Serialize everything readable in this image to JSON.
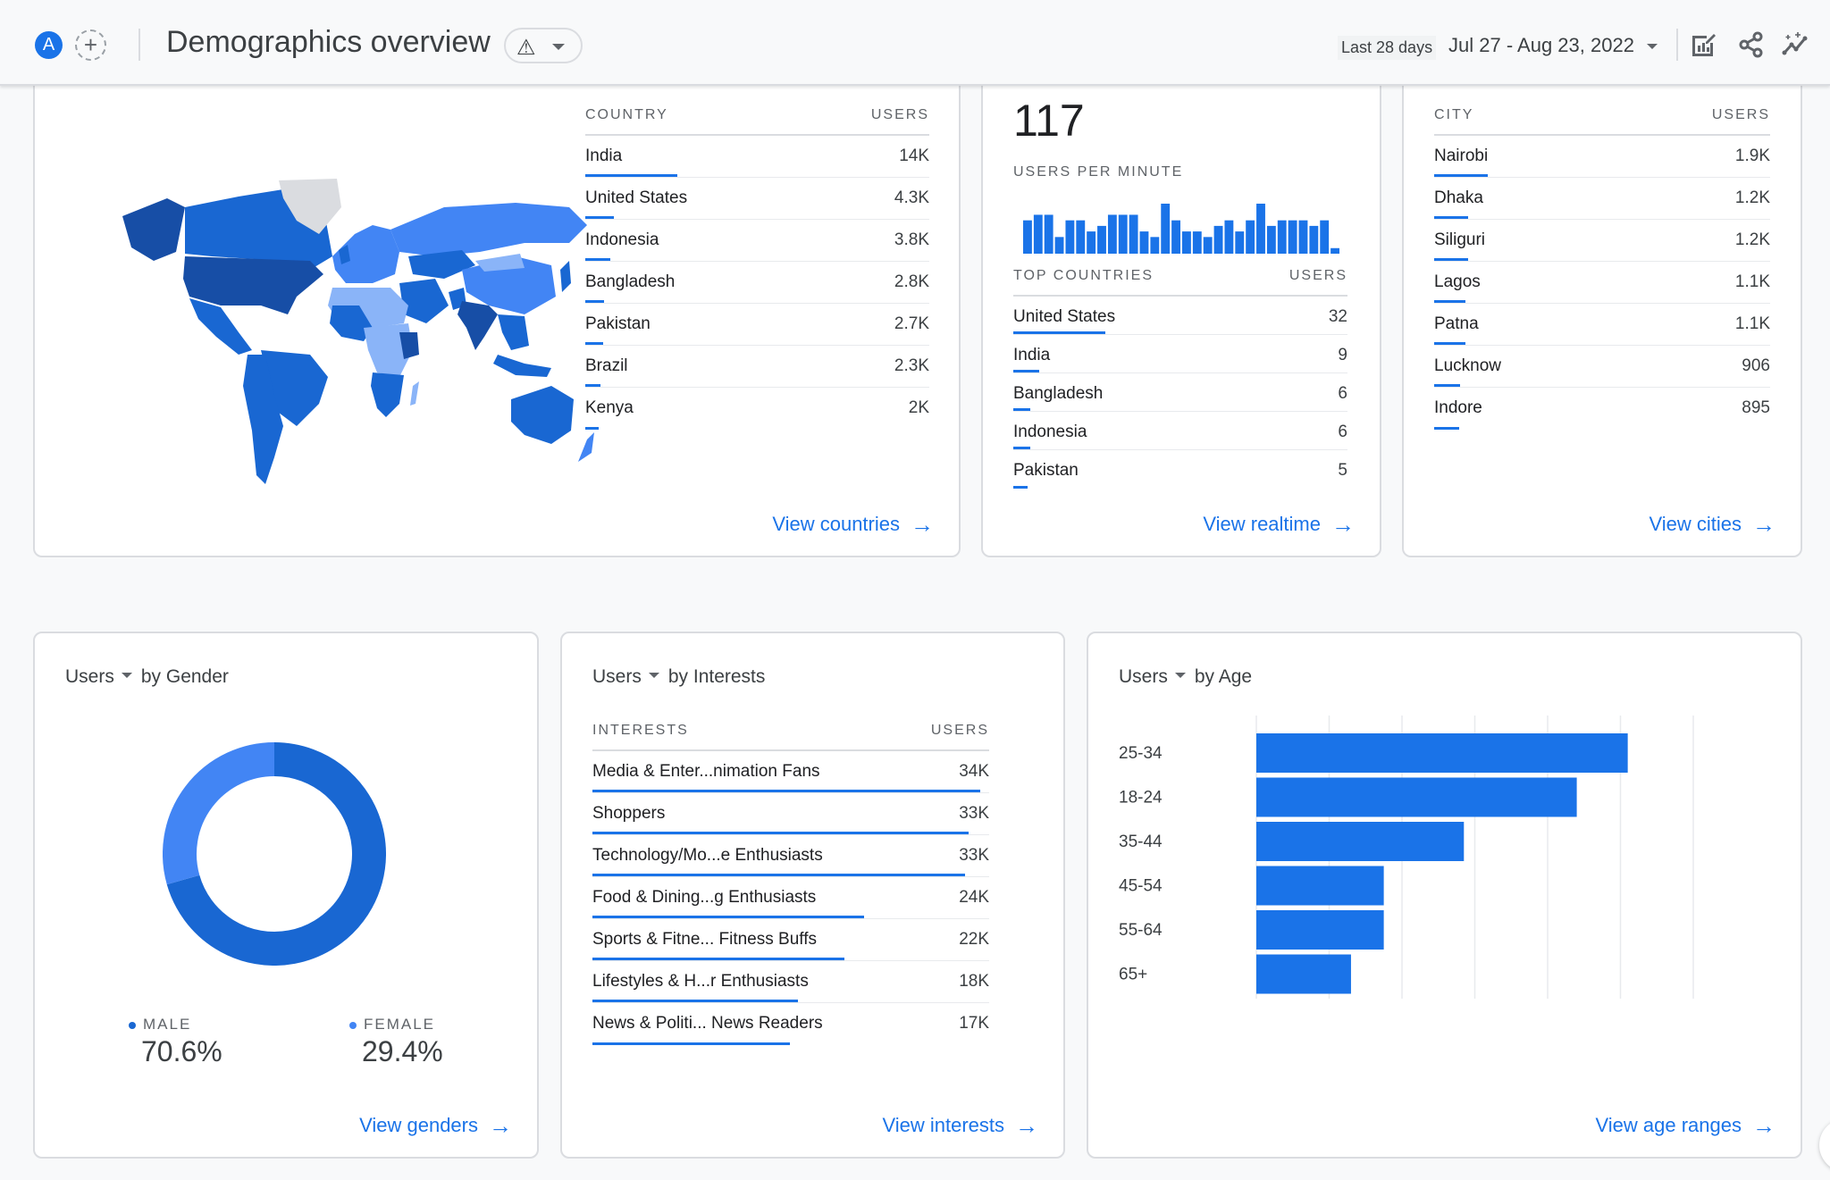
{
  "header": {
    "avatar_letter": "A",
    "add_comparison_icon": "plus-circle-dashed",
    "title": "Demographics overview",
    "warning_icon": "warning-triangle",
    "date_range_label": "Last 28 days",
    "date_range_value": "Jul 27 - Aug 23, 2022",
    "icons": [
      "customize-report-icon",
      "share-icon",
      "insights-icon"
    ]
  },
  "map_card": {
    "map": {
      "description": "World choropleth map of users by country",
      "colors": {
        "highest": "#174ea6",
        "high": "#1967d2",
        "medium": "#4285f4",
        "low": "#8ab4f8",
        "none": "#dadce0"
      }
    },
    "table": {
      "col_name": "COUNTRY",
      "col_value": "USERS",
      "rows": [
        {
          "name": "India",
          "value": "14K",
          "share": 1.0
        },
        {
          "name": "United States",
          "value": "4.3K",
          "share": 0.307
        },
        {
          "name": "Indonesia",
          "value": "3.8K",
          "share": 0.271
        },
        {
          "name": "Bangladesh",
          "value": "2.8K",
          "share": 0.2
        },
        {
          "name": "Pakistan",
          "value": "2.7K",
          "share": 0.193
        },
        {
          "name": "Brazil",
          "value": "2.3K",
          "share": 0.164
        },
        {
          "name": "Kenya",
          "value": "2K",
          "share": 0.143
        }
      ]
    },
    "link": "View countries"
  },
  "realtime_card": {
    "big_number": "117",
    "per_minute_label": "USERS PER MINUTE",
    "per_minute_values": [
      6,
      7,
      7,
      3,
      6,
      6,
      4,
      5,
      7,
      7,
      7,
      4,
      3,
      9,
      6,
      4,
      4,
      3,
      5,
      6,
      4,
      6,
      9,
      5,
      6,
      6,
      6,
      5,
      6,
      1
    ],
    "table": {
      "col_name": "TOP COUNTRIES",
      "col_value": "USERS",
      "rows": [
        {
          "name": "United States",
          "value": "32",
          "share": 1.0
        },
        {
          "name": "India",
          "value": "9",
          "share": 0.281
        },
        {
          "name": "Bangladesh",
          "value": "6",
          "share": 0.188
        },
        {
          "name": "Indonesia",
          "value": "6",
          "share": 0.188
        },
        {
          "name": "Pakistan",
          "value": "5",
          "share": 0.156
        }
      ]
    },
    "link": "View realtime"
  },
  "city_card": {
    "table": {
      "col_name": "CITY",
      "col_value": "USERS",
      "rows": [
        {
          "name": "Nairobi",
          "value": "1.9K",
          "share": 0.136
        },
        {
          "name": "Dhaka",
          "value": "1.2K",
          "share": 0.086
        },
        {
          "name": "Siliguri",
          "value": "1.2K",
          "share": 0.086
        },
        {
          "name": "Lagos",
          "value": "1.1K",
          "share": 0.079
        },
        {
          "name": "Patna",
          "value": "1.1K",
          "share": 0.079
        },
        {
          "name": "Lucknow",
          "value": "906",
          "share": 0.065
        },
        {
          "name": "Indore",
          "value": "895",
          "share": 0.064
        }
      ]
    },
    "link": "View cities"
  },
  "gender_card": {
    "metric": "Users",
    "dimension": "by Gender",
    "segments": [
      {
        "label": "MALE",
        "value": "70.6%",
        "fraction": 0.706,
        "color": "#1967d2"
      },
      {
        "label": "FEMALE",
        "value": "29.4%",
        "fraction": 0.294,
        "color": "#4285f4"
      }
    ],
    "link": "View genders"
  },
  "interests_card": {
    "metric": "Users",
    "dimension": "by Interests",
    "table": {
      "col_name": "INTERESTS",
      "col_value": "USERS",
      "rows": [
        {
          "name": "Media & Enter...nimation Fans",
          "value": "34K",
          "share": 1.0
        },
        {
          "name": "Shoppers",
          "value": "33K",
          "share": 0.97
        },
        {
          "name": "Technology/Mo...e Enthusiasts",
          "value": "33K",
          "share": 0.96
        },
        {
          "name": "Food & Dining...g Enthusiasts",
          "value": "24K",
          "share": 0.7
        },
        {
          "name": "Sports & Fitne... Fitness Buffs",
          "value": "22K",
          "share": 0.65
        },
        {
          "name": "Lifestyles & H...r Enthusiasts",
          "value": "18K",
          "share": 0.53
        },
        {
          "name": "News & Politi... News Readers",
          "value": "17K",
          "share": 0.51
        }
      ]
    },
    "link": "View interests"
  },
  "age_card": {
    "metric": "Users",
    "dimension": "by Age",
    "link": "View age ranges"
  },
  "chart_data": [
    {
      "type": "bar",
      "orientation": "horizontal",
      "title": "Users by Age",
      "categories": [
        "25-34",
        "18-24",
        "35-44",
        "45-54",
        "55-64",
        "65+"
      ],
      "values": [
        10200,
        8800,
        5700,
        3500,
        3500,
        2600
      ],
      "xlabel": "",
      "ylabel": "",
      "xlim": [
        0,
        12000
      ],
      "xticks": [
        "0",
        "2K",
        "4K",
        "6K",
        "8K",
        "10K",
        "12K"
      ],
      "grid": true,
      "color": "#1a73e8"
    },
    {
      "type": "pie",
      "title": "Users by Gender",
      "categories": [
        "MALE",
        "FEMALE"
      ],
      "values": [
        70.6,
        29.4
      ],
      "donut": true
    },
    {
      "type": "bar",
      "title": "Users per minute",
      "categories": [],
      "values": [
        6,
        7,
        7,
        3,
        6,
        6,
        4,
        5,
        7,
        7,
        7,
        4,
        3,
        9,
        6,
        4,
        4,
        3,
        5,
        6,
        4,
        6,
        9,
        5,
        6,
        6,
        6,
        5,
        6,
        1
      ]
    }
  ]
}
